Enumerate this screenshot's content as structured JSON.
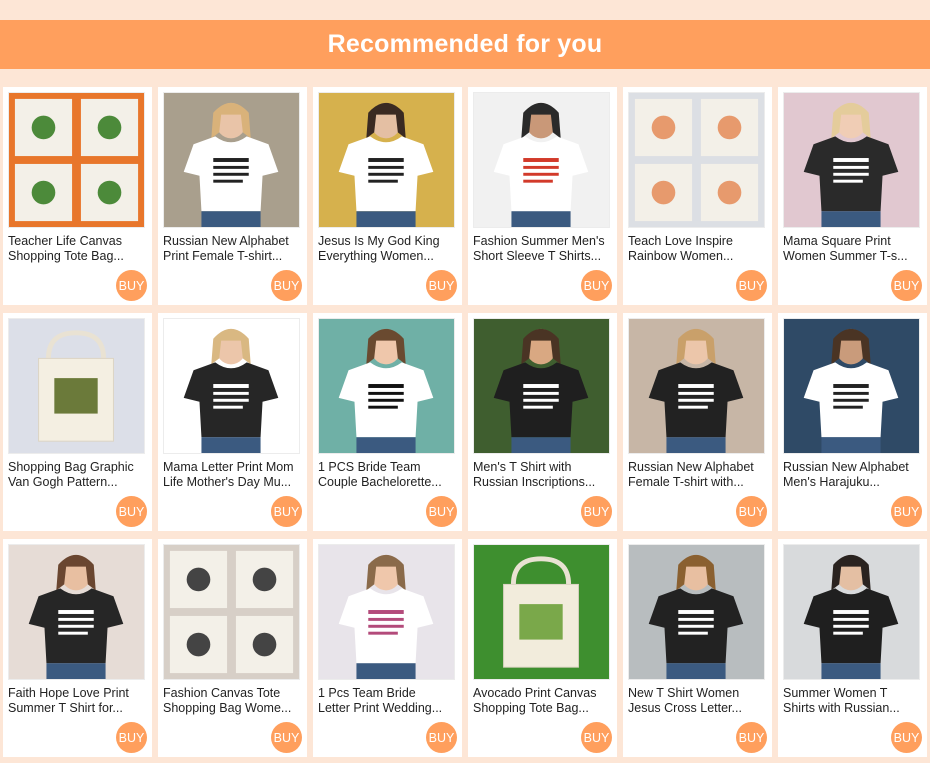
{
  "header": {
    "title": "Recommended for you"
  },
  "colors": {
    "accent": "#ff9f5d",
    "background": "#fde6d6"
  },
  "products": [
    {
      "line1": "Teacher Life Canvas",
      "line2": "Shopping Tote Bag...",
      "buy": "BUY",
      "image": "tote-bags-love-teacher"
    },
    {
      "line1": "Russian New Alphabet",
      "line2": "Print Female T-shirt...",
      "buy": "BUY",
      "image": "white-tshirt-alphabet"
    },
    {
      "line1": "Jesus Is My God King",
      "line2": "Everything Women...",
      "buy": "BUY",
      "image": "white-tshirt-jesus"
    },
    {
      "line1": "Fashion Summer Men's",
      "line2": "Short Sleeve T Shirts...",
      "buy": "BUY",
      "image": "white-tshirt-doner-kebab"
    },
    {
      "line1": "Teach Love Inspire",
      "line2": "Rainbow Women...",
      "buy": "BUY",
      "image": "tote-bags-rainbow"
    },
    {
      "line1": "Mama Square Print",
      "line2": "Women Summer T-s...",
      "buy": "BUY",
      "image": "black-tshirt-mama"
    },
    {
      "line1": "Shopping Bag Graphic",
      "line2": "Van Gogh Pattern...",
      "buy": "BUY",
      "image": "tote-bag-van-gogh"
    },
    {
      "line1": "Mama Letter Print Mom",
      "line2": "Life Mother's Day Mu...",
      "buy": "BUY",
      "image": "black-tshirt-mama-letter"
    },
    {
      "line1": "1 PCS Bride Team",
      "line2": "Couple Bachelorette...",
      "buy": "BUY",
      "image": "bride-team-tshirts"
    },
    {
      "line1": "Men's T Shirt with",
      "line2": "Russian Inscriptions...",
      "buy": "BUY",
      "image": "black-tshirt-man-beard"
    },
    {
      "line1": "Russian New Alphabet",
      "line2": "Female T-shirt with...",
      "buy": "BUY",
      "image": "black-tshirt-alphabet"
    },
    {
      "line1": "Russian New Alphabet",
      "line2": "Men's Harajuku...",
      "buy": "BUY",
      "image": "white-tshirt-man-alphabet"
    },
    {
      "line1": "Faith Hope Love Print",
      "line2": "Summer T Shirt for...",
      "buy": "BUY",
      "image": "black-tshirt-faith"
    },
    {
      "line1": "Fashion Canvas Tote",
      "line2": "Shopping Bag Wome...",
      "buy": "BUY",
      "image": "tote-bags-quotes"
    },
    {
      "line1": "1 Pcs Team Bride",
      "line2": "Letter Print Wedding...",
      "buy": "BUY",
      "image": "team-bride-tutus"
    },
    {
      "line1": "Avocado Print Canvas",
      "line2": "Shopping Tote Bag...",
      "buy": "BUY",
      "image": "tote-bags-avocado"
    },
    {
      "line1": "New T Shirt Women",
      "line2": "Jesus Cross Letter...",
      "buy": "BUY",
      "image": "black-tshirt-jesus-cross"
    },
    {
      "line1": "Summer Women T",
      "line2": "Shirts with Russian...",
      "buy": "BUY",
      "image": "black-tshirt-russian"
    }
  ]
}
